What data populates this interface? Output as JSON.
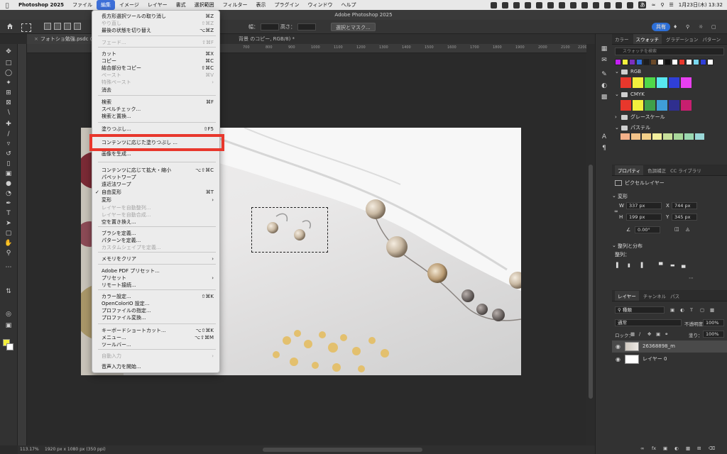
{
  "menubar": {
    "app": "Photoshop 2025",
    "items": [
      "ファイル",
      "編集",
      "イメージ",
      "レイヤー",
      "書式",
      "選択範囲",
      "フィルター",
      "表示",
      "プラグイン",
      "ウィンドウ",
      "ヘルプ"
    ],
    "active_index": 1,
    "input_mode": "あ",
    "date_time": "1月23日(木) 13:32"
  },
  "window_title": "Adobe Photoshop 2025",
  "optbar": {
    "width_label": "幅：",
    "height_label": "高さ：",
    "select_mask": "選択とマスク...",
    "share": "共有"
  },
  "doc": {
    "tab_name": "フォトショ勉強.psdc @ 1",
    "tab_rest": "背景 のコピー, RGB/8) *"
  },
  "ruler_ticks": [
    "700",
    "800",
    "900",
    "1000",
    "1100",
    "1200",
    "1300",
    "1400",
    "1500",
    "1600",
    "1700",
    "1800",
    "1900",
    "2000",
    "2100",
    "2200"
  ],
  "edit_menu": {
    "items": [
      {
        "label": "長方形選択ツールの取り消し",
        "shortcut": "⌘Z",
        "disabled": false
      },
      {
        "label": "やり直し",
        "shortcut": "⇧⌘Z",
        "disabled": true
      },
      {
        "label": "最後の状態を切り替え",
        "shortcut": "⌥⌘Z",
        "disabled": false
      },
      {
        "label": "フェード...",
        "shortcut": "⇧⌘F",
        "disabled": true
      },
      {
        "label": "カット",
        "shortcut": "⌘X",
        "disabled": false
      },
      {
        "label": "コピー",
        "shortcut": "⌘C",
        "disabled": false
      },
      {
        "label": "結合部分をコピー",
        "shortcut": "⇧⌘C",
        "disabled": false
      },
      {
        "label": "ペースト",
        "shortcut": "⌘V",
        "disabled": true
      },
      {
        "label": "特殊ペースト",
        "shortcut": "",
        "disabled": true,
        "submenu": true
      },
      {
        "label": "消去",
        "shortcut": "",
        "disabled": false
      },
      {
        "label": "検索",
        "shortcut": "⌘F",
        "disabled": false
      },
      {
        "label": "スペルチェック...",
        "shortcut": "",
        "disabled": false
      },
      {
        "label": "検索と置換...",
        "shortcut": "",
        "disabled": false
      },
      {
        "label": "塗りつぶし...",
        "shortcut": "⇧F5",
        "disabled": false
      },
      {
        "label": "コンテンツに応じた塗りつぶし ...",
        "shortcut": "",
        "disabled": false
      },
      {
        "label": "画像を生成...",
        "shortcut": "",
        "disabled": false
      },
      {
        "label": "コンテンツに応じて拡大・縮小",
        "shortcut": "⌥⇧⌘C",
        "disabled": false
      },
      {
        "label": "パペットワープ",
        "shortcut": "",
        "disabled": false
      },
      {
        "label": "遠近法ワープ",
        "shortcut": "",
        "disabled": false
      },
      {
        "label": "自由変形",
        "shortcut": "⌘T",
        "disabled": false,
        "checked": true
      },
      {
        "label": "変形",
        "shortcut": "",
        "disabled": false,
        "submenu": true
      },
      {
        "label": "レイヤーを自動整列...",
        "shortcut": "",
        "disabled": true
      },
      {
        "label": "レイヤーを自動合成...",
        "shortcut": "",
        "disabled": true
      },
      {
        "label": "空を置き換え...",
        "shortcut": "",
        "disabled": false
      },
      {
        "label": "ブラシを定義...",
        "shortcut": "",
        "disabled": false
      },
      {
        "label": "パターンを定義...",
        "shortcut": "",
        "disabled": false
      },
      {
        "label": "カスタムシェイプを定義...",
        "shortcut": "",
        "disabled": true
      },
      {
        "label": "メモリをクリア",
        "shortcut": "",
        "disabled": false,
        "submenu": true
      },
      {
        "label": "Adobe PDF プリセット...",
        "shortcut": "",
        "disabled": false
      },
      {
        "label": "プリセット",
        "shortcut": "",
        "disabled": false,
        "submenu": true
      },
      {
        "label": "リモート接続...",
        "shortcut": "",
        "disabled": false
      },
      {
        "label": "カラー設定...",
        "shortcut": "⇧⌘K",
        "disabled": false
      },
      {
        "label": "OpenColorIO 設定...",
        "shortcut": "",
        "disabled": false
      },
      {
        "label": "プロファイルの指定...",
        "shortcut": "",
        "disabled": false
      },
      {
        "label": "プロファイル変換...",
        "shortcut": "",
        "disabled": false
      },
      {
        "label": "キーボードショートカット...",
        "shortcut": "⌥⇧⌘K",
        "disabled": false
      },
      {
        "label": "メニュー...",
        "shortcut": "⌥⇧⌘M",
        "disabled": false
      },
      {
        "label": "ツールバー...",
        "shortcut": "",
        "disabled": false
      },
      {
        "label": "自動入力",
        "shortcut": "",
        "disabled": true,
        "submenu": true
      },
      {
        "label": "音声入力を開始...",
        "shortcut": "",
        "disabled": false
      }
    ]
  },
  "swatches_panel": {
    "tabs": [
      "カラー",
      "スウォッチ",
      "グラデーション",
      "パターン"
    ],
    "active_tab": 1,
    "search_placeholder": "スウォッチを検索",
    "recent": [
      "#c31ff3",
      "#f3ef3d",
      "#7b2fbe",
      "#2f6fd8",
      "#1d1d1d",
      "#6a4a2a",
      "#ffffff",
      "#111111",
      "#ffffff",
      "#e8372c",
      "#f3f3f3",
      "#7ad8f0",
      "#2f3fd8",
      "#ffffff"
    ],
    "groups": [
      {
        "name": "RGB",
        "colors": [
          "#e8372c",
          "#f3ef3d",
          "#50d84a",
          "#58e8f0",
          "#2f3fd8",
          "#e83ff0"
        ]
      },
      {
        "name": "CMYK",
        "colors": [
          "#e8372c",
          "#f3ef3d",
          "#3fa04a",
          "#3f9ed8",
          "#2f2f8f",
          "#c81f6f"
        ]
      },
      {
        "name": "グレースケール",
        "colors": []
      },
      {
        "name": "パステル",
        "colors": [
          "#f3b089",
          "#f3c389",
          "#f3d089",
          "#f3ef9d",
          "#c8e09a",
          "#a8d89a",
          "#9ad8b0",
          "#9ad8d8"
        ]
      }
    ]
  },
  "properties_panel": {
    "tabs": [
      "プロパティ",
      "色調補正",
      "CC ライブラリ"
    ],
    "layer_kind": "ピクセルレイヤー",
    "transform_title": "変形",
    "w": "337 px",
    "h": "199 px",
    "x": "744 px",
    "y": "345 px",
    "angle": "0.00°",
    "align_title": "整列と分布",
    "align_label": "整列："
  },
  "layers_panel": {
    "tabs": [
      "レイヤー",
      "チャンネル",
      "パス"
    ],
    "kind": "種類",
    "blend_mode": "通常",
    "opacity_label": "不透明度：",
    "opacity": "100%",
    "lock_label": "ロック：",
    "fill_label": "塗り：",
    "fill": "100%",
    "layers": [
      {
        "name": "26368898_m",
        "selected": true
      },
      {
        "name": "レイヤー 0",
        "selected": false
      }
    ]
  },
  "status": {
    "zoom": "113.17%",
    "dims": "1920 px x 1080 px (350 ppi)"
  }
}
